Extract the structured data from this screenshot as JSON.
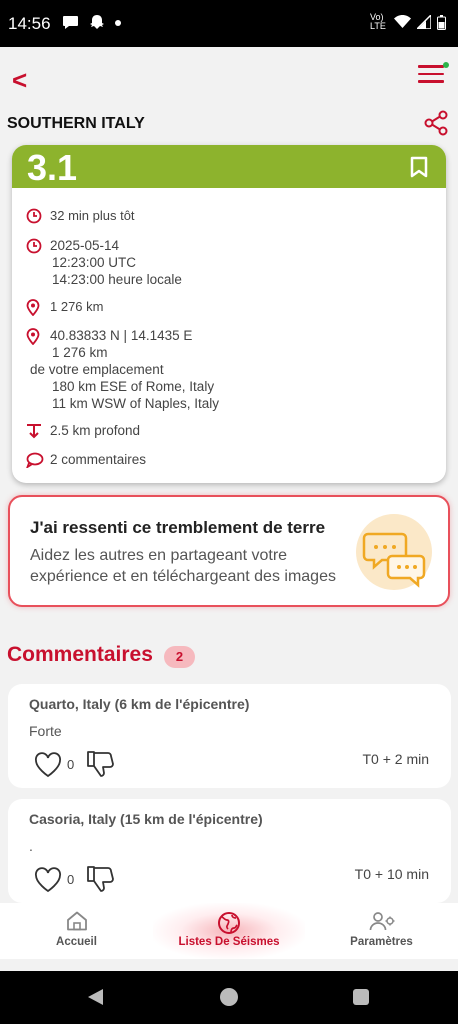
{
  "status_bar": {
    "time": "14:56",
    "network_label": "Vo) LTE"
  },
  "app_bar": {
    "back_label": "<"
  },
  "region_title": "SOUTHERN ITALY",
  "quake": {
    "magnitude": "3.1",
    "magnitude_color": "#8db32d",
    "relative_time": "32 min plus tôt",
    "date": "2025-05-14",
    "utc_time": "12:23:00 UTC",
    "local_time": "14:23:00 heure locale",
    "distance": "1 276 km",
    "coordinates": "40.83833 N | 14.1435 E",
    "distance_from_you": "1 276 km",
    "from_location_label": "de votre emplacement",
    "nearby_1": "180 km ESE of Rome, Italy",
    "nearby_2": "11 km WSW of Naples, Italy",
    "depth": "2.5 km profond",
    "comment_count_label": "2  commentaires"
  },
  "felt_card": {
    "title": "J'ai ressenti ce tremblement de terre",
    "description": "Aidez les autres en partageant votre expérience et en téléchargeant des images"
  },
  "comments_section": {
    "heading": "Commentaires",
    "count": "2",
    "items": [
      {
        "location": "Quarto, Italy (6 km de l'épicentre)",
        "text": "Forte",
        "likes": "0",
        "time": "T0 + 2 min"
      },
      {
        "location": "Casoria, Italy (15 km de l'épicentre)",
        "text": ".",
        "likes": "0",
        "time": "T0 + 10 min"
      }
    ]
  },
  "bottom_nav": {
    "items": [
      {
        "label": "Accueil",
        "icon": "home-icon"
      },
      {
        "label": "Listes De Séismes",
        "icon": "globe-icon",
        "active": true
      },
      {
        "label": "Paramètres",
        "icon": "user-settings-icon"
      }
    ]
  },
  "colors": {
    "accent": "#c8102e",
    "magnitude_bar": "#8db32d",
    "felt_border": "#e8505b"
  }
}
